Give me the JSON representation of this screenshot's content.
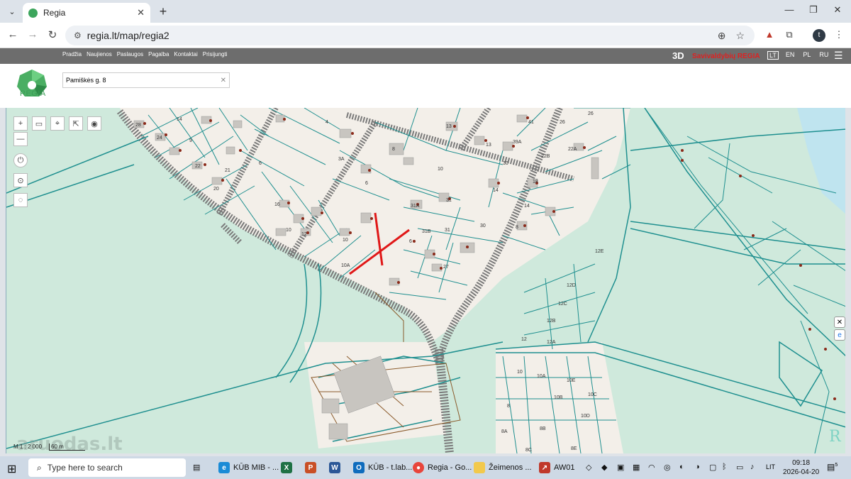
{
  "browser": {
    "tab_title": "Regia",
    "url": "regia.lt/map/regia2",
    "profile_initial": "t"
  },
  "header": {
    "nav": [
      "Pradžia",
      "Naujienos",
      "Paslaugos",
      "Pagalba",
      "Kontaktai",
      "Prisijungti"
    ],
    "mode_3d": "3D",
    "municipality_label": "Savivaldybių REGIA",
    "languages": [
      "LT",
      "EN",
      "PL",
      "RU"
    ],
    "active_language": "LT",
    "logo_text": "REGIA"
  },
  "search": {
    "value": "Pamiškės g. 8"
  },
  "map": {
    "scale_text": "M 1 : 2 000",
    "distance_text": "60 m",
    "watermark": "aruodas.lt",
    "parcel_labels": [
      "28",
      "26",
      "24",
      "14",
      "9",
      "22",
      "21",
      "20",
      "6",
      "16",
      "10",
      "12",
      "4",
      "3A",
      "8",
      "10",
      "13",
      "13",
      "41",
      "39A",
      "26",
      "22B",
      "22A",
      "18",
      "14",
      "14",
      "8",
      "31A",
      "31B",
      "31",
      "31",
      "30",
      "30",
      "27",
      "6",
      "6",
      "10A",
      "10",
      "12E",
      "12D",
      "12C",
      "12B",
      "12A",
      "12",
      "10",
      "10A",
      "10B",
      "10C",
      "10D",
      "10E",
      "8",
      "8A",
      "8B",
      "8C",
      "8E"
    ]
  },
  "taskbar": {
    "search_placeholder": "Type here to search",
    "apps": [
      "KŪB MIB - ...",
      "KŪB - t.lab...",
      "Regia - Go...",
      "Žeimenos ...",
      "AW01"
    ],
    "language": "LIT",
    "time": "09:18",
    "date": "2026-04-20",
    "notification_count": "5"
  }
}
